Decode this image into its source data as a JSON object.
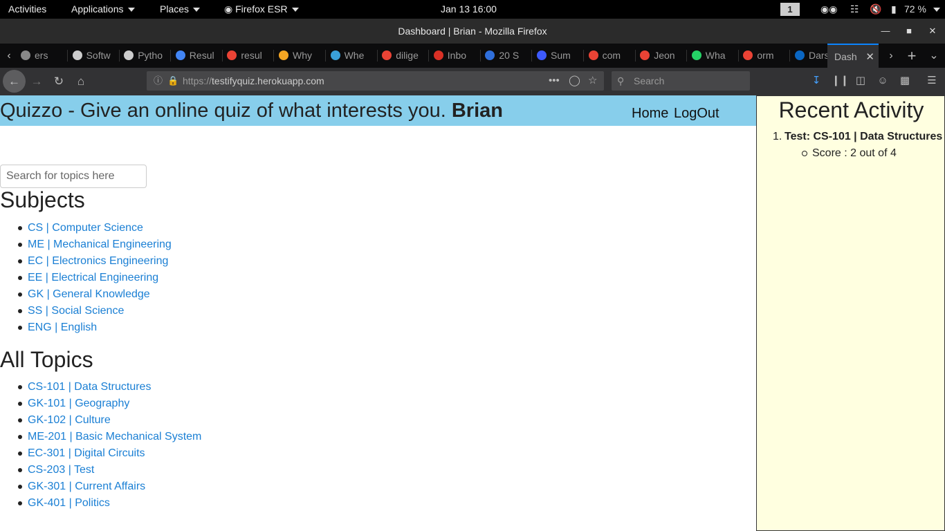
{
  "system_bar": {
    "activities": "Activities",
    "applications": "Applications",
    "places": "Places",
    "app_name": "Firefox ESR",
    "clock": "Jan 13  16:00",
    "workspace": "1",
    "battery": "72 %"
  },
  "window": {
    "title": "Dashboard | Brian - Mozilla Firefox"
  },
  "tabs": [
    {
      "label": "ers",
      "color": "#888888"
    },
    {
      "label": "Softw",
      "color": "#cccccc"
    },
    {
      "label": "Pytho",
      "color": "#cccccc"
    },
    {
      "label": "Resul",
      "color": "#4285f4"
    },
    {
      "label": "resul",
      "color": "#ea4335"
    },
    {
      "label": "Why",
      "color": "#f5a623"
    },
    {
      "label": "Whe",
      "color": "#3aa0d8"
    },
    {
      "label": "dilige",
      "color": "#ea4335"
    },
    {
      "label": "Inbo",
      "color": "#d93025"
    },
    {
      "label": "20 S",
      "color": "#2f6fdc"
    },
    {
      "label": "Sum",
      "color": "#3d5afe"
    },
    {
      "label": "com",
      "color": "#ea4335"
    },
    {
      "label": "Jeon",
      "color": "#ea4335"
    },
    {
      "label": "Wha",
      "color": "#25d366"
    },
    {
      "label": "orm",
      "color": "#ea4335"
    },
    {
      "label": "Dars",
      "color": "#0a66c2"
    }
  ],
  "active_tab": {
    "label": "Dash"
  },
  "nav": {
    "url_scheme": "https://",
    "url_host": "testifyquiz.herokuapp.com",
    "search_placeholder": "Search"
  },
  "header": {
    "brand": "Quizzo - Give an online quiz of what interests you.",
    "user": "Brian",
    "home": "Home",
    "logout": "LogOut"
  },
  "search": {
    "placeholder": "Search for topics here"
  },
  "subjects": {
    "heading": "Subjects",
    "items": [
      "CS | Computer Science",
      "ME | Mechanical Engineering",
      "EC | Electronics Engineering",
      "EE | Electrical Engineering",
      "GK | General Knowledge",
      "SS | Social Science",
      "ENG | English"
    ]
  },
  "topics": {
    "heading": "All Topics",
    "items": [
      "CS-101 | Data Structures",
      "GK-101 | Geography",
      "GK-102 | Culture",
      "ME-201 | Basic Mechanical System",
      "EC-301 | Digital Circuits",
      "CS-203 | Test",
      "GK-301 | Current Affairs",
      "GK-401 | Politics"
    ]
  },
  "activity": {
    "heading": "Recent Activity",
    "num": "1.",
    "item": "Test: CS-101 | Data Structures",
    "score": "Score : 2 out of 4"
  },
  "colors": {
    "header_bg": "#87ceeb",
    "link": "#1a7fd4",
    "activity_bg": "#ffffe0",
    "tab_accent": "#0a84ff"
  }
}
